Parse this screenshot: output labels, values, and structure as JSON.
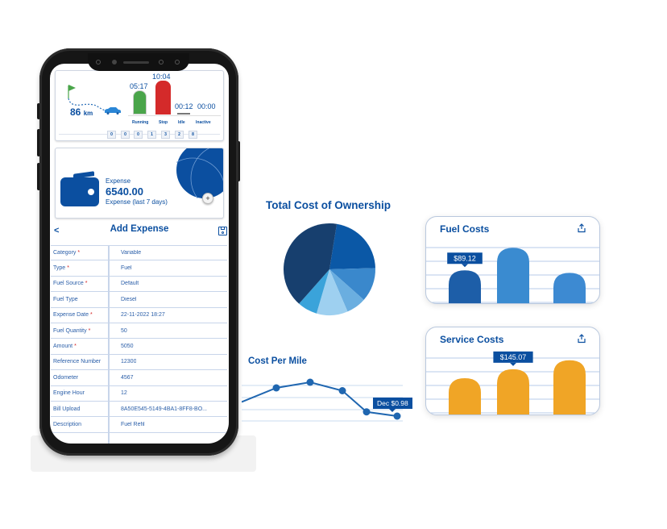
{
  "phone": {
    "trip_card": {
      "distance_value": "86",
      "distance_unit": "km",
      "statuses": [
        {
          "label": "Running",
          "time": "05:17",
          "color": "#4aa54a",
          "fill": 0.55
        },
        {
          "label": "Stop",
          "time": "10:04",
          "color": "#d42a2a",
          "fill": 1.0
        },
        {
          "label": "Idle",
          "time": "00:12",
          "color": "#888888",
          "fill": 0.05
        },
        {
          "label": "Inactive",
          "time": "00:00",
          "color": "#888888",
          "fill": 0
        }
      ],
      "odometer_digits": [
        "0",
        "0",
        "0",
        "1",
        "3",
        "2",
        "8"
      ]
    },
    "expense_card": {
      "label": "Expense",
      "value": "6540.00",
      "subtitle": "Expense (last 7 days)",
      "plus_icon": "+"
    },
    "form": {
      "back_label": "<",
      "title": "Add Expense",
      "save_icon": "save-icon",
      "rows": [
        {
          "label": "Category",
          "required": "*",
          "value": "Variable"
        },
        {
          "label": "Type",
          "required": "*",
          "value": "Fuel"
        },
        {
          "label": "Fuel Source",
          "required": "*",
          "value": "Default"
        },
        {
          "label": "Fuel Type",
          "required": "",
          "value": "Diesel"
        },
        {
          "label": "Expense Date",
          "required": "*",
          "value": "22-11-2022 18:27"
        },
        {
          "label": "Fuel Quantity",
          "required": "*",
          "value": "50"
        },
        {
          "label": "Amount",
          "required": "*",
          "value": "5050"
        },
        {
          "label": "Reference Number",
          "required": "",
          "value": "12300"
        },
        {
          "label": "Odometer",
          "required": "",
          "value": "4567"
        },
        {
          "label": "Engine Hour",
          "required": "",
          "value": "12"
        },
        {
          "label": "Bill Upload",
          "required": "",
          "value": "8A50E545-5149-4BA1-8FF8-BO..."
        },
        {
          "label": "Description",
          "required": "",
          "value": "Fuel Refil"
        },
        {
          "label": "",
          "required": "",
          "value": ""
        }
      ]
    }
  },
  "chart_data": [
    {
      "type": "pie",
      "title": "Total Cost of Ownership",
      "values": [
        22,
        12,
        7,
        11,
        7,
        41
      ],
      "colors": [
        "#0b58a6",
        "#3a88cc",
        "#6aaee0",
        "#9ed0f0",
        "#3aa3da",
        "#173f6e"
      ],
      "categories": [
        "",
        "",
        "",
        "",
        "",
        ""
      ]
    },
    {
      "type": "line",
      "title": "Cost Per Mile",
      "x": [
        0,
        1,
        2,
        3,
        4,
        5,
        6
      ],
      "values": [
        1.08,
        1.18,
        1.22,
        1.16,
        1.01,
        0.98,
        0.98
      ],
      "marker_points": [
        1,
        2,
        3,
        4,
        5
      ],
      "annotation": "Dec $0.98",
      "ylim": [
        0.9,
        1.3
      ],
      "color": "#1f66b0"
    },
    {
      "type": "bar",
      "title": "Fuel Costs",
      "values": [
        89.12,
        170,
        80
      ],
      "categories": [
        "",
        "",
        ""
      ],
      "annotation": "$89.12",
      "annotated_index": 0,
      "colors": [
        "#1d5ea8",
        "#3a8bd0",
        "#3d8ad2"
      ],
      "ylim": [
        0,
        200
      ]
    },
    {
      "type": "bar",
      "title": "Service Costs",
      "values": [
        110,
        145.07,
        180
      ],
      "categories": [
        "",
        "",
        ""
      ],
      "annotation": "$145.07",
      "annotated_index": 1,
      "colors": [
        "#f0a526",
        "#f0a526",
        "#f0a526"
      ],
      "ylim": [
        0,
        220
      ]
    }
  ]
}
